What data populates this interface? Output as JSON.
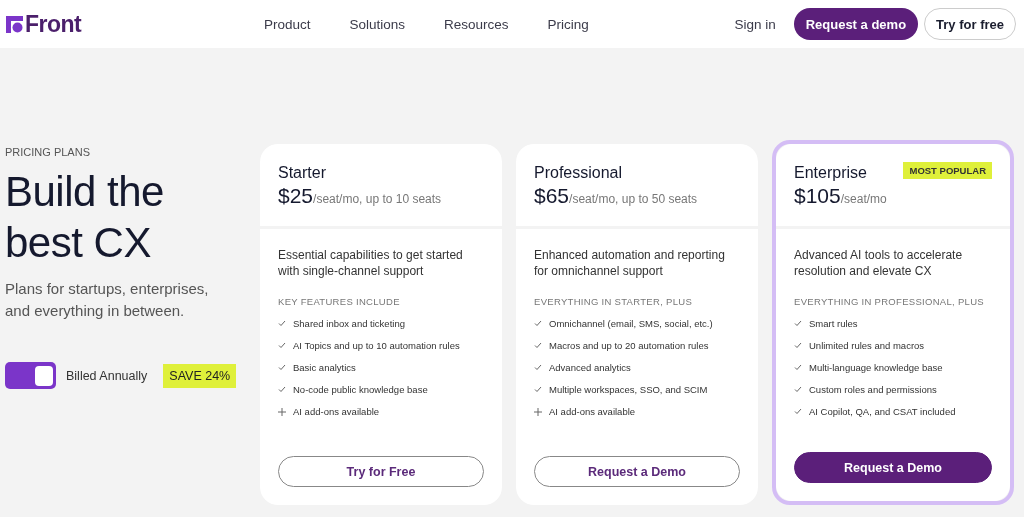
{
  "header": {
    "logo": "Front",
    "nav": [
      "Product",
      "Solutions",
      "Resources",
      "Pricing"
    ],
    "sign_in": "Sign in",
    "primary_button": "Request a demo",
    "secondary_button": "Try for free"
  },
  "intro": {
    "eyebrow": "PRICING PLANS",
    "title_lines": [
      "Build the",
      "best CX"
    ],
    "subtitle_lines": [
      "Plans for startups, enterprises,",
      "and everything in between."
    ],
    "billing_toggle": {
      "on": true,
      "label": "Billed Annually"
    },
    "badge": "SAVE 24%"
  },
  "plans": [
    {
      "name": "Starter",
      "price": "$25",
      "price_note": "/seat/mo, up to 10 seats",
      "featured": false,
      "description_lines": [
        "Essential capabilities to get started",
        "with single-channel support"
      ],
      "features_heading": "KEY FEATURES INCLUDE",
      "features": [
        {
          "kind": "check",
          "text": "Shared inbox and ticketing"
        },
        {
          "kind": "check",
          "text": "AI Topics and up to 10 automation rules"
        },
        {
          "kind": "check",
          "text": "Basic analytics"
        },
        {
          "kind": "check",
          "text": "No-code public knowledge base"
        },
        {
          "kind": "plus",
          "text": "AI add-ons available"
        }
      ],
      "button": {
        "kind": "outline",
        "label": "Try for Free"
      }
    },
    {
      "name": "Professional",
      "price": "$65",
      "price_note": "/seat/mo, up to 50 seats",
      "featured": false,
      "description_lines": [
        "Enhanced automation and reporting",
        "for omnichannel support"
      ],
      "features_heading": "EVERYTHING IN STARTER, PLUS",
      "features": [
        {
          "kind": "check",
          "text": "Omnichannel (email, SMS, social, etc.)"
        },
        {
          "kind": "check",
          "text": "Macros and up to 20 automation rules"
        },
        {
          "kind": "check",
          "text": "Advanced analytics"
        },
        {
          "kind": "check",
          "text": "Multiple workspaces, SSO, and SCIM"
        },
        {
          "kind": "plus",
          "text": "AI add-ons available"
        }
      ],
      "button": {
        "kind": "outline",
        "label": "Request a Demo"
      }
    },
    {
      "name": "Enterprise",
      "price": "$105",
      "price_note": "/seat/mo",
      "featured": true,
      "badge": "MOST POPULAR",
      "description_lines": [
        "Advanced AI tools to accelerate",
        "resolution and elevate CX"
      ],
      "features_heading": "EVERYTHING IN PROFESSIONAL, PLUS",
      "features": [
        {
          "kind": "check",
          "text": "Smart rules"
        },
        {
          "kind": "check",
          "text": "Unlimited rules and macros"
        },
        {
          "kind": "check",
          "text": "Multi-language knowledge base"
        },
        {
          "kind": "check",
          "text": "Custom roles and permissions"
        },
        {
          "kind": "check",
          "text": "AI Copilot, QA, and CSAT included"
        }
      ],
      "button": {
        "kind": "filled",
        "label": "Request a Demo"
      }
    }
  ]
}
